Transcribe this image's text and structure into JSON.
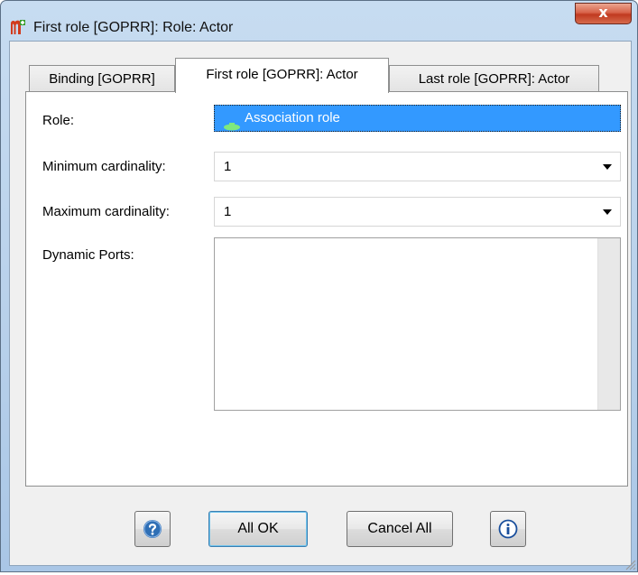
{
  "window": {
    "title": "First role [GOPRR]: Role: Actor",
    "close_glyph": "x"
  },
  "tabs": [
    {
      "label": "Binding [GOPRR]",
      "active": false
    },
    {
      "label": "First role [GOPRR]: Actor",
      "active": true
    },
    {
      "label": "Last role [GOPRR]: Actor",
      "active": false
    }
  ],
  "form": {
    "role_label": "Role:",
    "role_value": "Association role",
    "min_card_label": "Minimum cardinality:",
    "min_card_value": "1",
    "max_card_label": "Maximum cardinality:",
    "max_card_value": "1",
    "ports_label": "Dynamic Ports:",
    "ports_items": []
  },
  "buttons": {
    "help_icon": "question-icon",
    "ok_label": "All OK",
    "cancel_label": "Cancel All",
    "info_icon": "info-icon"
  },
  "colors": {
    "selection": "#3399ff",
    "role_icon": "#7ee87e",
    "help_icon": "#2f6fb5",
    "info_icon": "#1a4f9c"
  }
}
